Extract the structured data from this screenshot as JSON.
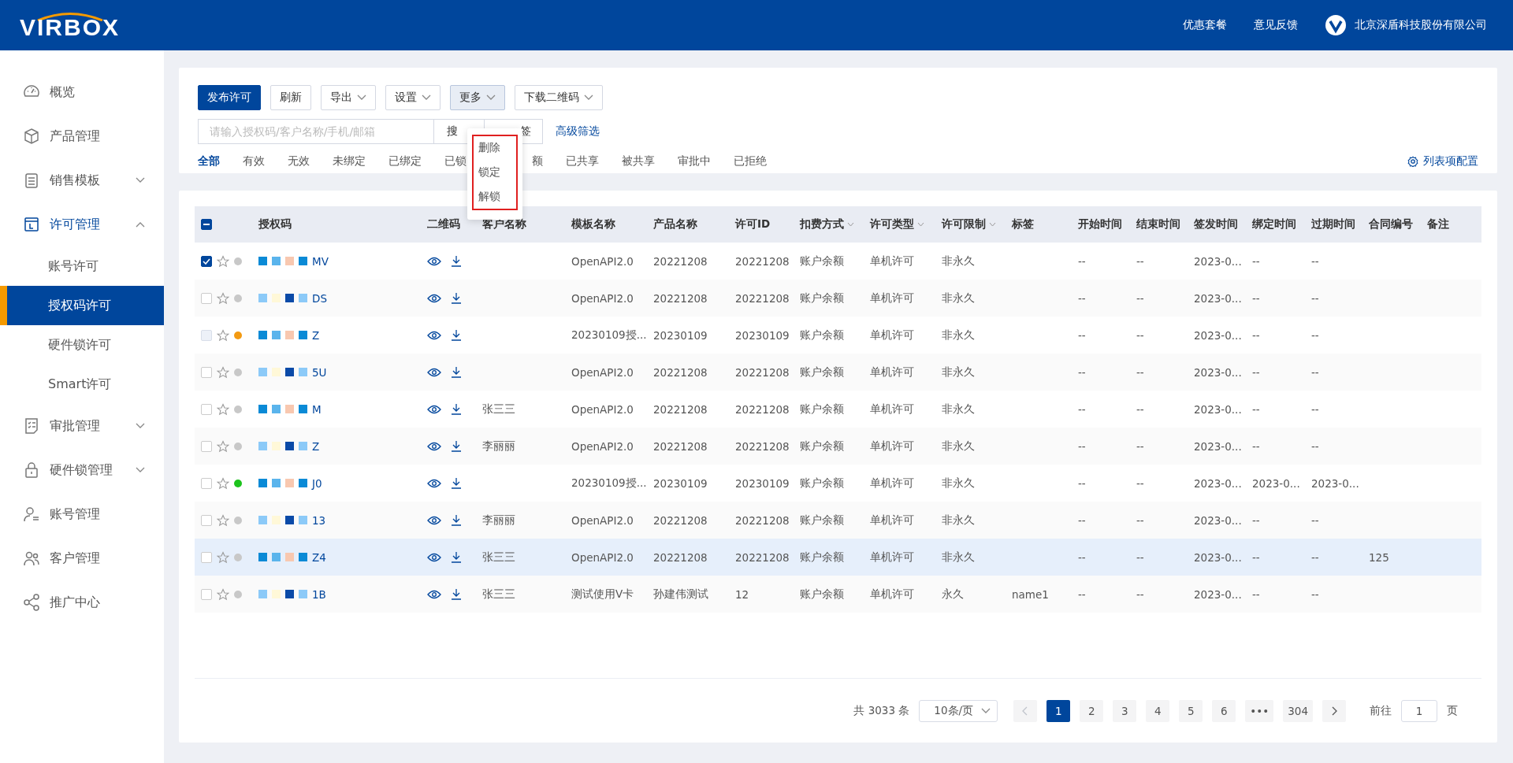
{
  "header": {
    "logo": "VIRBOX",
    "links": [
      "优惠套餐",
      "意见反馈"
    ],
    "company": "北京深盾科技股份有限公司"
  },
  "sidebar": {
    "items": [
      {
        "label": "概览"
      },
      {
        "label": "产品管理"
      },
      {
        "label": "销售模板",
        "expanded": false
      },
      {
        "label": "许可管理",
        "expanded": true,
        "children": [
          {
            "label": "账号许可",
            "selected": false
          },
          {
            "label": "授权码许可",
            "selected": true
          },
          {
            "label": "硬件锁许可",
            "selected": false
          },
          {
            "label": "Smart许可",
            "selected": false
          }
        ]
      },
      {
        "label": "审批管理",
        "expanded": false
      },
      {
        "label": "硬件锁管理",
        "expanded": false
      },
      {
        "label": "账号管理"
      },
      {
        "label": "客户管理"
      },
      {
        "label": "推广中心"
      }
    ]
  },
  "toolbar": {
    "buttons": [
      {
        "label": "发布许可",
        "kind": "primary",
        "dropdown": false,
        "active": false
      },
      {
        "label": "刷新",
        "kind": "plain",
        "dropdown": false,
        "active": false
      },
      {
        "label": "导出",
        "kind": "plain",
        "dropdown": true,
        "active": false
      },
      {
        "label": "设置",
        "kind": "plain",
        "dropdown": true,
        "active": false
      },
      {
        "label": "更多",
        "kind": "plain",
        "dropdown": true,
        "active": true
      },
      {
        "label": "下载二维码",
        "kind": "plain",
        "dropdown": true,
        "active": false
      }
    ],
    "search": {
      "placeholder": "请输入授权码/客户名称/手机/邮箱",
      "buttons": [
        "搜",
        "签"
      ]
    },
    "advanced_filter": "高级筛选",
    "filters": [
      {
        "label": "全部",
        "selected": true
      },
      {
        "label": "有效",
        "selected": false
      },
      {
        "label": "无效",
        "selected": false
      },
      {
        "label": "未绑定",
        "selected": false
      },
      {
        "label": "已绑定",
        "selected": false
      },
      {
        "label": "已锁",
        "selected": false
      },
      {
        "label": "额",
        "selected": false
      },
      {
        "label": "已共享",
        "selected": false
      },
      {
        "label": "被共享",
        "selected": false
      },
      {
        "label": "审批中",
        "selected": false
      },
      {
        "label": "已拒绝",
        "selected": false
      }
    ],
    "column_config": "列表项配置"
  },
  "more_menu": {
    "items": [
      "删除",
      "锁定",
      "解锁"
    ],
    "outlined": true
  },
  "table": {
    "select_all": {
      "indeterminate": true
    },
    "columns": [
      {
        "label": "授权码",
        "sortable": false
      },
      {
        "label": "二维码",
        "sortable": false
      },
      {
        "label": "客户名称",
        "sortable": false
      },
      {
        "label": "模板名称",
        "sortable": false
      },
      {
        "label": "产品名称",
        "sortable": false
      },
      {
        "label": "许可ID",
        "sortable": false
      },
      {
        "label": "扣费方式",
        "sortable": true
      },
      {
        "label": "许可类型",
        "sortable": true
      },
      {
        "label": "许可限制",
        "sortable": true
      },
      {
        "label": "标签",
        "sortable": false
      },
      {
        "label": "开始时间",
        "sortable": false
      },
      {
        "label": "结束时间",
        "sortable": false
      },
      {
        "label": "签发时间",
        "sortable": false
      },
      {
        "label": "绑定时间",
        "sortable": false
      },
      {
        "label": "过期时间",
        "sortable": false
      },
      {
        "label": "合同编号",
        "sortable": false
      },
      {
        "label": "备注",
        "sortable": false
      }
    ],
    "rows": [
      {
        "checked": true,
        "disabled": false,
        "highlighted": false,
        "color": "#c8c8c8",
        "code": "MV",
        "template": "OpenAPI2.0",
        "product": "20221208",
        "license_id": "20221208",
        "billing": "账户余额",
        "license_type": "单机许可",
        "limit": "非永久",
        "start": "--",
        "end": "--",
        "issued": "2023-0...",
        "bound": "--",
        "expires": "--"
      },
      {
        "checked": false,
        "disabled": false,
        "highlighted": false,
        "color": "#c8c8c8",
        "code": "DS",
        "template": "OpenAPI2.0",
        "product": "20221208",
        "license_id": "20221208",
        "billing": "账户余额",
        "license_type": "单机许可",
        "limit": "非永久",
        "start": "--",
        "end": "--",
        "issued": "2023-0...",
        "bound": "--",
        "expires": "--"
      },
      {
        "checked": false,
        "disabled": true,
        "highlighted": false,
        "color": "#f39a12",
        "code": "Z",
        "template": "20230109授...",
        "product": "20230109",
        "license_id": "20230109",
        "billing": "账户余额",
        "license_type": "单机许可",
        "limit": "非永久",
        "start": "--",
        "end": "--",
        "issued": "2023-0...",
        "bound": "--",
        "expires": "--"
      },
      {
        "checked": false,
        "disabled": false,
        "highlighted": false,
        "color": "#c8c8c8",
        "code": "5U",
        "template": "OpenAPI2.0",
        "product": "20221208",
        "license_id": "20221208",
        "billing": "账户余额",
        "license_type": "单机许可",
        "limit": "非永久",
        "start": "--",
        "end": "--",
        "issued": "2023-0...",
        "bound": "--",
        "expires": "--"
      },
      {
        "checked": false,
        "disabled": false,
        "highlighted": false,
        "color": "#c8c8c8",
        "code": "M",
        "customer": "张三三",
        "template": "OpenAPI2.0",
        "product": "20221208",
        "license_id": "20221208",
        "billing": "账户余额",
        "license_type": "单机许可",
        "limit": "非永久",
        "start": "--",
        "end": "--",
        "issued": "2023-0...",
        "bound": "--",
        "expires": "--"
      },
      {
        "checked": false,
        "disabled": false,
        "highlighted": false,
        "color": "#c8c8c8",
        "code": "Z",
        "customer": "李丽丽",
        "template": "OpenAPI2.0",
        "product": "20221208",
        "license_id": "20221208",
        "billing": "账户余额",
        "license_type": "单机许可",
        "limit": "非永久",
        "start": "--",
        "end": "--",
        "issued": "2023-0...",
        "bound": "--",
        "expires": "--"
      },
      {
        "checked": false,
        "disabled": false,
        "highlighted": false,
        "color": "#1dc31d",
        "code": "J0",
        "template": "20230109授...",
        "product": "20230109",
        "license_id": "20230109",
        "billing": "账户余额",
        "license_type": "单机许可",
        "limit": "非永久",
        "start": "--",
        "end": "--",
        "issued": "2023-0...",
        "bound": "2023-0...",
        "expires": "2023-0..."
      },
      {
        "checked": false,
        "disabled": false,
        "highlighted": false,
        "color": "#c8c8c8",
        "code": "13",
        "customer": "李丽丽",
        "template": "OpenAPI2.0",
        "product": "20221208",
        "license_id": "20221208",
        "billing": "账户余额",
        "license_type": "单机许可",
        "limit": "非永久",
        "start": "--",
        "end": "--",
        "issued": "2023-0...",
        "bound": "--",
        "expires": "--"
      },
      {
        "checked": false,
        "disabled": false,
        "highlighted": true,
        "color": "#c8c8c8",
        "code": "Z4",
        "customer": "张三三",
        "template": "OpenAPI2.0",
        "product": "20221208",
        "license_id": "20221208",
        "billing": "账户余额",
        "license_type": "单机许可",
        "limit": "非永久",
        "start": "--",
        "end": "--",
        "issued": "2023-0...",
        "bound": "--",
        "expires": "--",
        "contract": "125"
      },
      {
        "checked": false,
        "disabled": false,
        "highlighted": false,
        "color": "#c8c8c8",
        "code": "1B",
        "customer": "张三三",
        "template": "测试使用V卡",
        "product": "孙建伟测试",
        "license_id": "12",
        "billing": "账户余额",
        "license_type": "单机许可",
        "limit": "永久",
        "tag": "name1",
        "start": "--",
        "end": "--",
        "issued": "2023-0...",
        "bound": "--",
        "expires": "--"
      }
    ]
  },
  "pagination": {
    "total": "共 3033 条",
    "page_size": "10条/页",
    "pages": [
      {
        "label": "1",
        "selected": true
      },
      {
        "label": "2",
        "selected": false
      },
      {
        "label": "3",
        "selected": false
      },
      {
        "label": "4",
        "selected": false
      },
      {
        "label": "5",
        "selected": false
      },
      {
        "label": "6",
        "selected": false
      },
      {
        "label": "•••",
        "selected": false
      },
      {
        "label": "304",
        "selected": false
      }
    ],
    "goto_label": "前往",
    "goto_value": "1",
    "goto_suffix": "页"
  }
}
